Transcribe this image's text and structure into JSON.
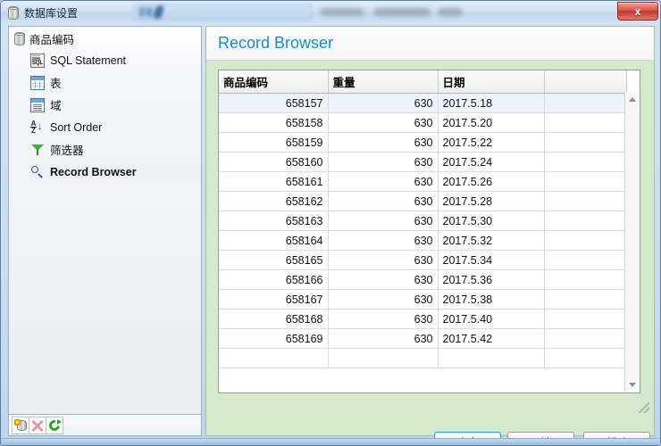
{
  "window": {
    "title": "数据库设置",
    "title_icon": "database-icon",
    "close_label": "x"
  },
  "sidebar": {
    "root": {
      "label": "商品编码",
      "icon": "database-icon"
    },
    "items": [
      {
        "label": "SQL Statement",
        "icon": "sql-document-icon",
        "selected": false
      },
      {
        "label": "表",
        "icon": "table-grid-icon",
        "selected": false
      },
      {
        "label": "域",
        "icon": "fields-icon",
        "selected": false
      },
      {
        "label": "Sort Order",
        "icon": "sort-az-icon",
        "selected": false
      },
      {
        "label": "筛选器",
        "icon": "funnel-filter-icon",
        "selected": false
      },
      {
        "label": "Record Browser",
        "icon": "magnifier-icon",
        "selected": true
      }
    ],
    "toolbar": [
      {
        "name": "add-database-button",
        "icon": "database-add-icon"
      },
      {
        "name": "delete-button",
        "icon": "red-x-icon"
      },
      {
        "name": "refresh-button",
        "icon": "refresh-icon"
      }
    ]
  },
  "panel": {
    "title": "Record Browser",
    "title_color": "#1a8ec4",
    "background_color": "#d5e9cd"
  },
  "grid": {
    "columns": [
      "商品编码",
      "重量",
      "日期",
      ""
    ],
    "selected_row_index": 0,
    "rows": [
      [
        "658157",
        "630",
        "2017.5.18",
        ""
      ],
      [
        "658158",
        "630",
        "2017.5.20",
        ""
      ],
      [
        "658159",
        "630",
        "2017.5.22",
        ""
      ],
      [
        "658160",
        "630",
        "2017.5.24",
        ""
      ],
      [
        "658161",
        "630",
        "2017.5.26",
        ""
      ],
      [
        "658162",
        "630",
        "2017.5.28",
        ""
      ],
      [
        "658163",
        "630",
        "2017.5.30",
        ""
      ],
      [
        "658164",
        "630",
        "2017.5.32",
        ""
      ],
      [
        "658165",
        "630",
        "2017.5.34",
        ""
      ],
      [
        "658166",
        "630",
        "2017.5.36",
        ""
      ],
      [
        "658167",
        "630",
        "2017.5.38",
        ""
      ],
      [
        "658168",
        "630",
        "2017.5.40",
        ""
      ],
      [
        "658169",
        "630",
        "2017.5.42",
        ""
      ],
      [
        "",
        "",
        "",
        ""
      ]
    ],
    "scrollbar": {
      "up_icon": "chevron-up-icon",
      "down_icon": "chevron-down-icon"
    }
  },
  "buttons": {
    "ok": "确定",
    "cancel": "取消",
    "help": "帮助"
  }
}
